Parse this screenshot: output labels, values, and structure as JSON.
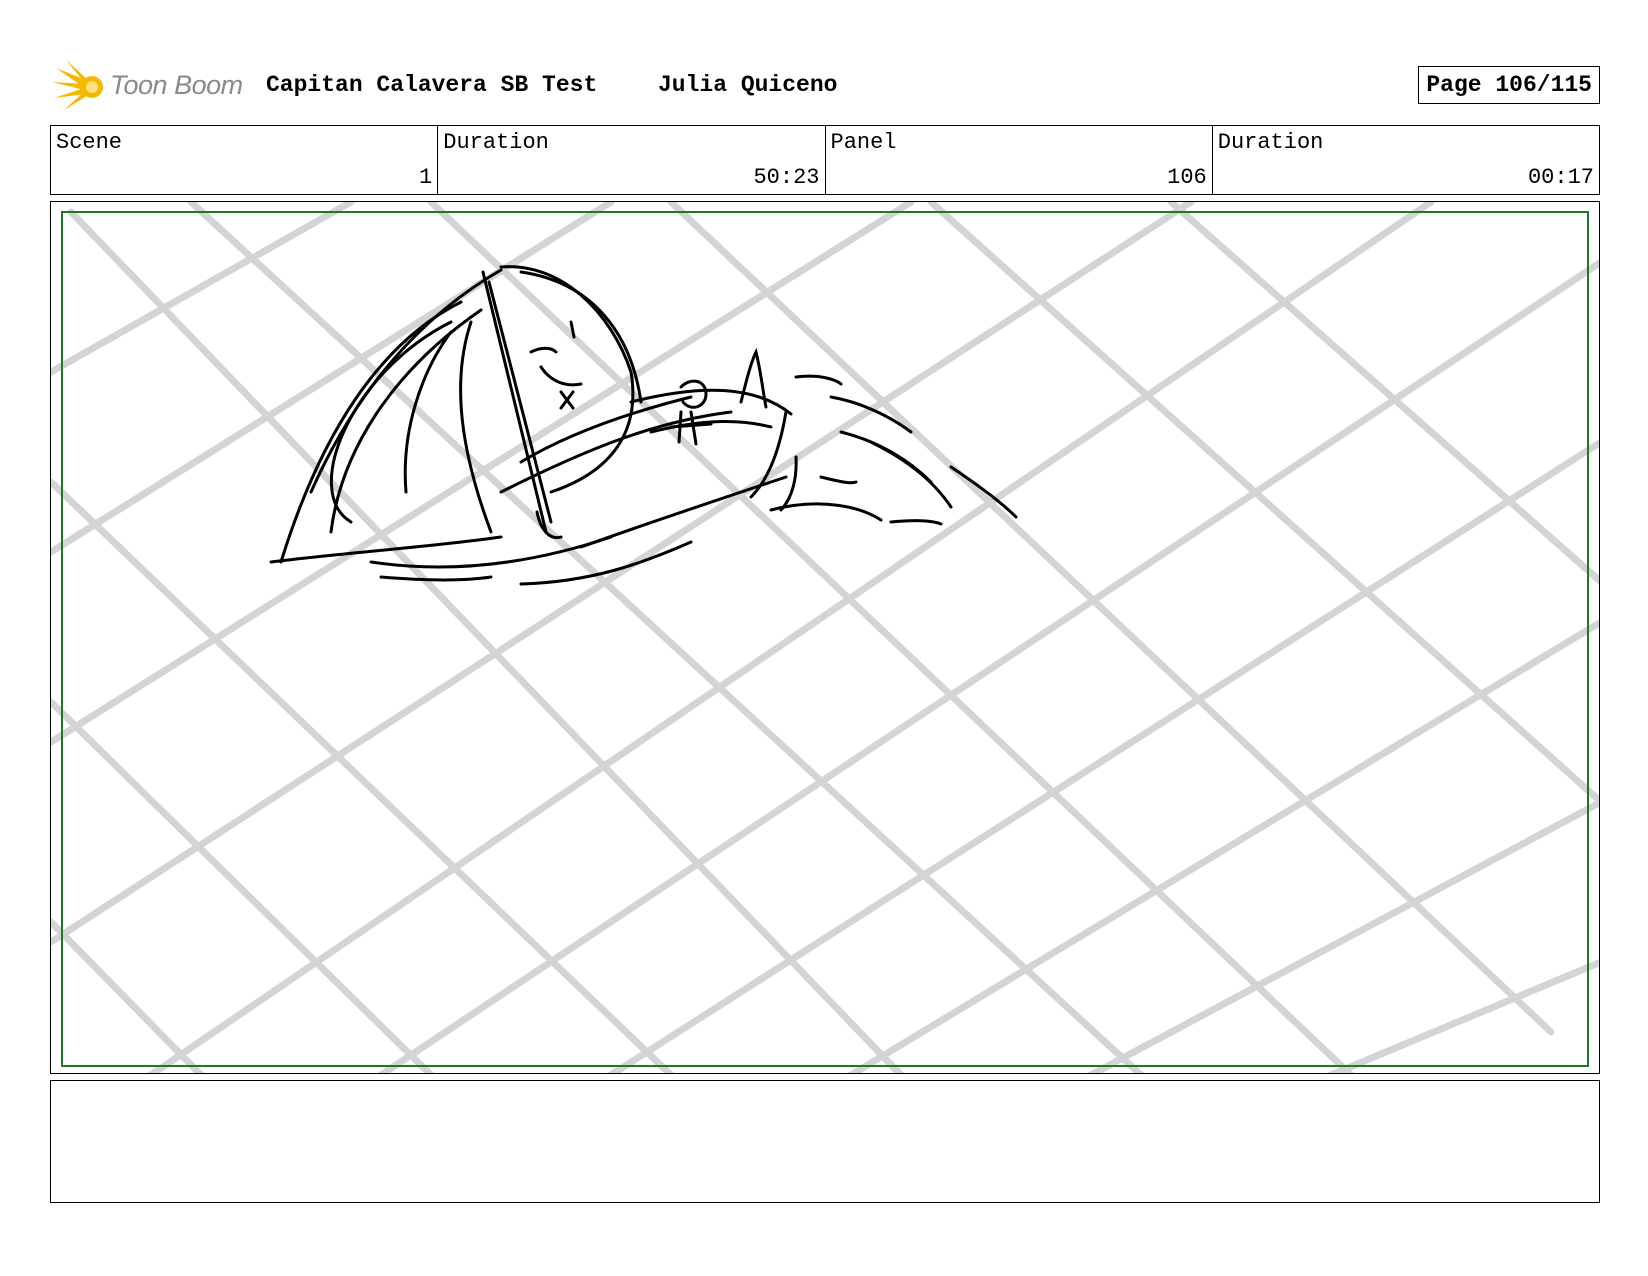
{
  "header": {
    "logo_text": "Toon Boom",
    "project_title": "Capitan Calavera SB Test",
    "author": "Julia Quiceno",
    "page_label": "Page 106/115"
  },
  "info": {
    "scene_label": "Scene",
    "scene_value": "1",
    "scene_duration_label": "Duration",
    "scene_duration_value": "50:23",
    "panel_label": "Panel",
    "panel_value": "106",
    "panel_duration_label": "Duration",
    "panel_duration_value": "00:17"
  },
  "panel": {
    "safe_frame_color": "#1f7a1f",
    "grid_color": "#d4d4d4",
    "sketch_color": "#000000"
  },
  "notes": {
    "text": ""
  }
}
